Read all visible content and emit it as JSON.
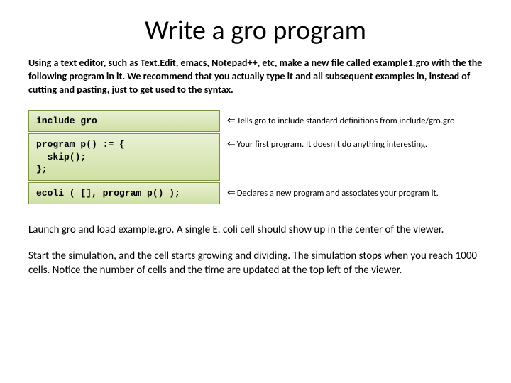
{
  "title": "Write a gro program",
  "intro": "Using a text editor, such as Text.Edit, emacs, Notepad++, etc, make a new file called example1.gro with the the following program in it. We recommend that you actually type it and all subsequent examples in, instead of cutting and pasting, just to get used to the syntax.",
  "rows": [
    {
      "code": "include gro",
      "note": "Tells gro to include standard definitions from include/gro.gro"
    },
    {
      "code": "program p() := {\n  skip();\n};",
      "note": "Your first program. It doesn't do anything interesting."
    },
    {
      "code": "ecoli ( [], program p() );",
      "note": "Declares a new program and associates your program it."
    }
  ],
  "outro1": "Launch gro and load example.gro. A single E. coli cell should show up in the center of the viewer.",
  "outro2": "Start the simulation, and the cell starts growing and dividing. The simulation stops when you reach 1000 cells. Notice the number of cells and the time are updated at the top left of the viewer.",
  "arrow_glyph": "⇐"
}
